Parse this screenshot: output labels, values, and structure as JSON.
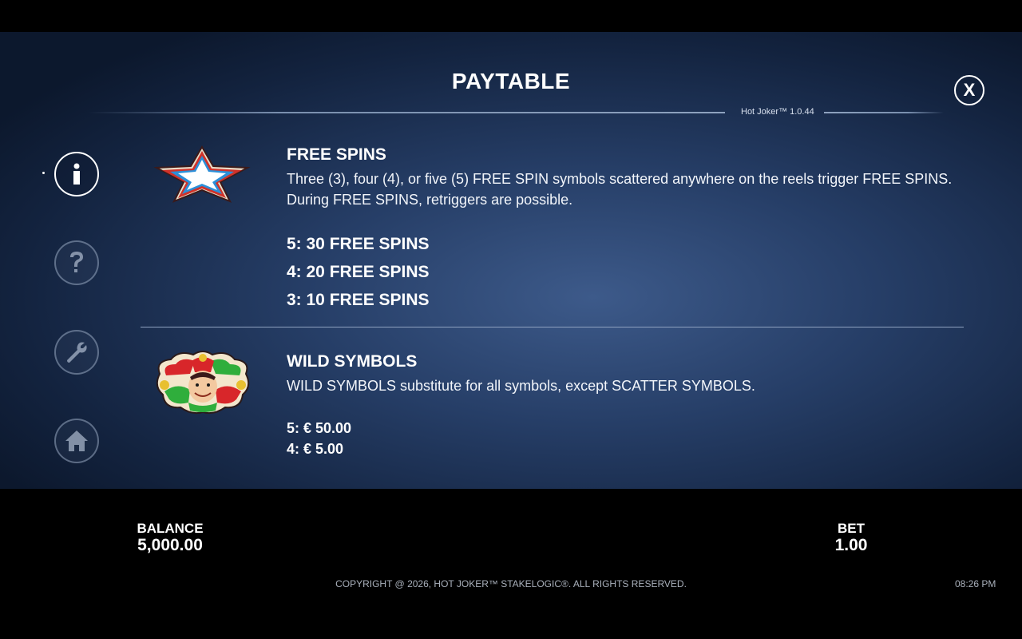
{
  "header": {
    "title": "PAYTABLE",
    "close_label": "X",
    "version": "Hot Joker™ 1.0.44"
  },
  "sidebar": {
    "items": [
      {
        "name": "info",
        "icon": "info-icon",
        "active": true
      },
      {
        "name": "help",
        "icon": "question-icon",
        "active": false
      },
      {
        "name": "settings",
        "icon": "wrench-icon",
        "active": false
      },
      {
        "name": "home",
        "icon": "home-icon",
        "active": false
      }
    ]
  },
  "sections": {
    "free_spins": {
      "icon": "star-scatter-icon",
      "title": "FREE SPINS",
      "line1": "Three (3), four (4), or five (5) FREE SPIN symbols scattered anywhere on the reels trigger FREE SPINS.",
      "line2": "During FREE SPINS, retriggers are possible.",
      "payouts": [
        "5: 30 FREE SPINS",
        "4: 20 FREE SPINS",
        "3: 10 FREE SPINS"
      ]
    },
    "wild": {
      "icon": "joker-wild-icon",
      "title": "WILD SYMBOLS",
      "description": "WILD SYMBOLS substitute for all symbols, except SCATTER SYMBOLS.",
      "payouts": [
        "5: € 50.00",
        "4: € 5.00"
      ]
    }
  },
  "footer": {
    "balance_label": "BALANCE",
    "balance_value": "5,000.00",
    "bet_label": "BET",
    "bet_value": "1.00",
    "copyright": "COPYRIGHT @ 2026, HOT JOKER™ STAKELOGIC®. ALL RIGHTS RESERVED.",
    "time": "08:26 PM"
  },
  "colors": {
    "panel_center": "#3d5a8a",
    "panel_edge": "#0c182d",
    "star_red": "#d0322a",
    "star_blue": "#2c8fd8"
  }
}
